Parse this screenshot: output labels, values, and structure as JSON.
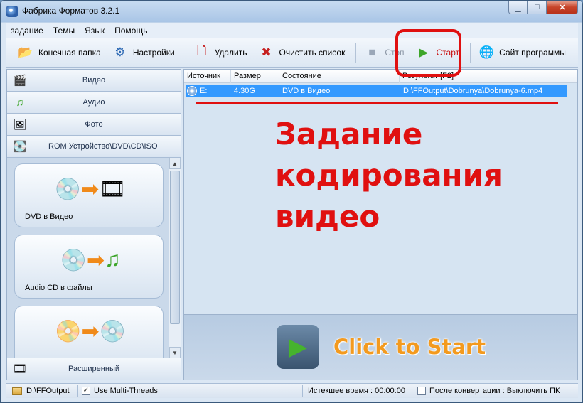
{
  "window": {
    "title": "Фабрика Форматов 3.2.1",
    "min": "▁",
    "max": "□",
    "close": "✕"
  },
  "menu": [
    "задание",
    "Темы",
    "Язык",
    "Помощь"
  ],
  "toolbar": {
    "output_folder": "Конечная папка",
    "settings": "Настройки",
    "delete": "Удалить",
    "clear_list": "Очистить список",
    "stop": "Стоп",
    "start": "Старт",
    "website": "Сайт программы"
  },
  "categories": {
    "video": "Видео",
    "audio": "Аудио",
    "photo": "Фото",
    "rom": "ROM Устройство\\DVD\\CD\\ISO",
    "advanced": "Расширенный"
  },
  "conversions": [
    {
      "label": "DVD в Видео",
      "icon": "dvd-to-video-icon"
    },
    {
      "label": "Audio CD в файлы",
      "icon": "cd-to-audio-icon"
    },
    {
      "label": "",
      "icon": "dvd-to-cd-icon"
    }
  ],
  "table": {
    "headers": [
      "Источник",
      "Размер",
      "Состояние",
      "Результат [F2]"
    ],
    "rows": [
      {
        "source": "E:",
        "size": "4.30G",
        "status": "DVD в Видео",
        "output": "D:\\FFOutput\\Dobrunya\\Dobrunya-6.mp4"
      }
    ]
  },
  "overlay_text": [
    "Задание",
    "кодирования",
    "видео"
  ],
  "click_to_start": "Click to Start",
  "status": {
    "folder": "D:\\FFOutput",
    "multithread_label": "Use Multi-Threads",
    "multithread_checked": true,
    "elapsed": "Истекшее время : 00:00:00",
    "after_convert": "После конвертации : Выключить ПК"
  },
  "colors": {
    "selection": "#3399ff",
    "annotation_red": "#e01010",
    "click_to_start": "#f39a1f"
  }
}
